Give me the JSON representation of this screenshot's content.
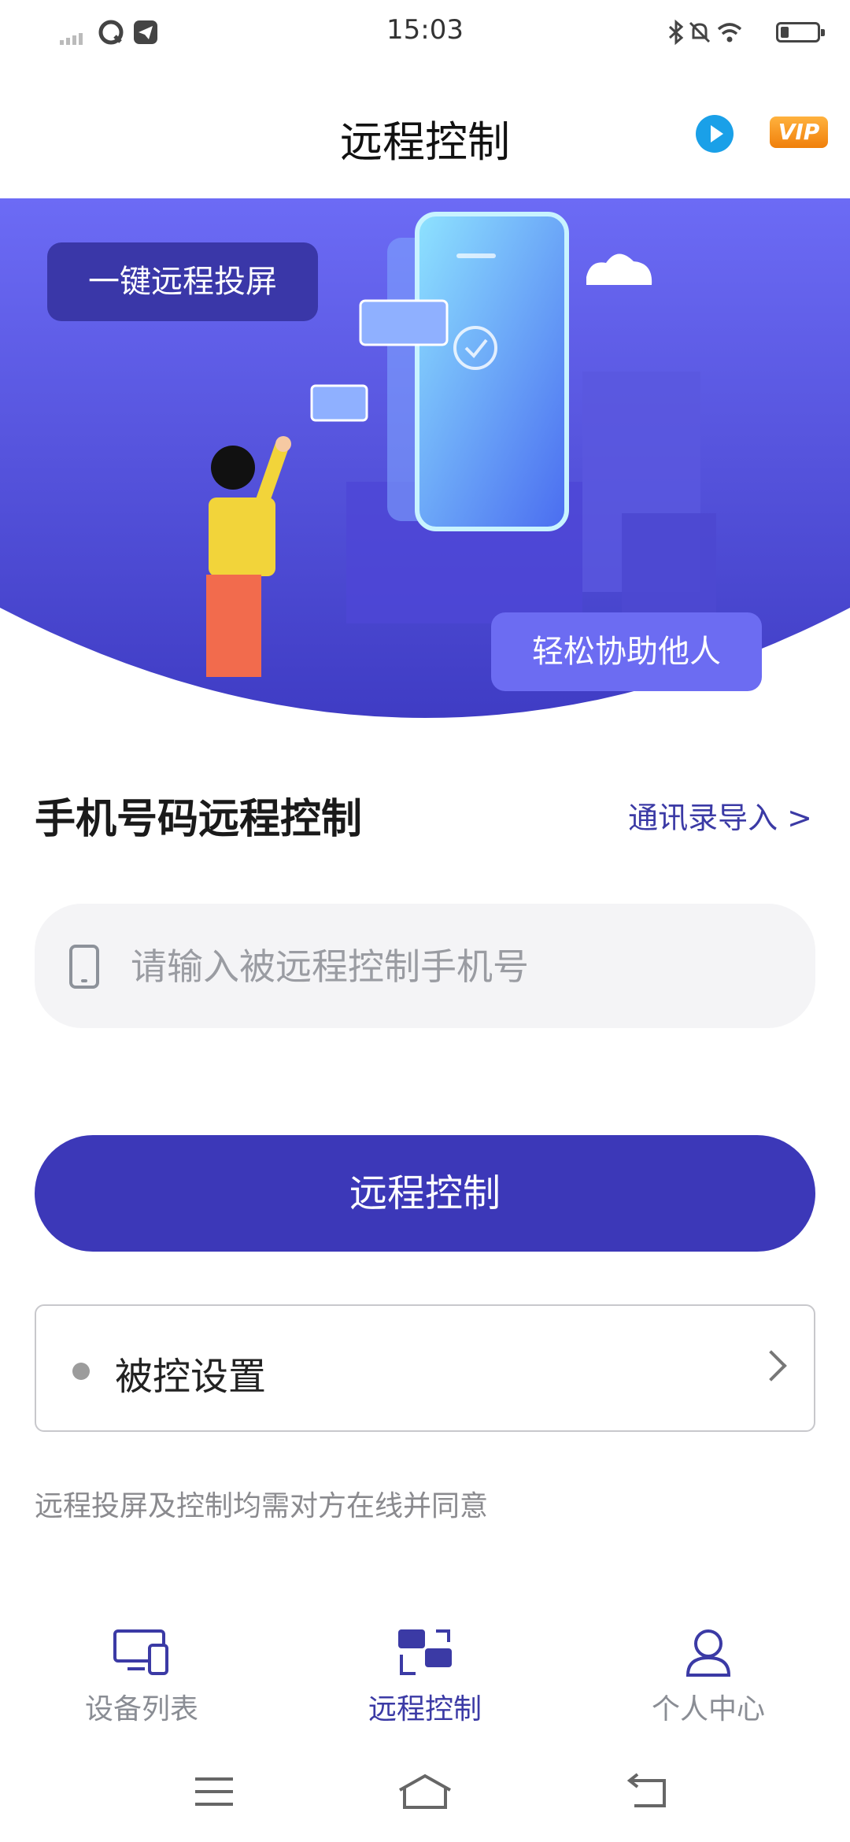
{
  "status_bar": {
    "time": "15:03"
  },
  "header": {
    "title": "远程控制",
    "vip_label": "VIP"
  },
  "banner": {
    "tag_top": "一键远程投屏",
    "tag_bottom": "轻松协助他人"
  },
  "section": {
    "title": "手机号码远程控制",
    "contacts_link": "通讯录导入 >"
  },
  "phone_input": {
    "placeholder": "请输入被远程控制手机号",
    "value": ""
  },
  "primary_button": {
    "label": "远程控制"
  },
  "settings_row": {
    "label": "被控设置"
  },
  "notice": "远程投屏及控制均需对方在线并同意",
  "tabs": [
    {
      "label": "设备列表",
      "icon": "devices-icon",
      "active": false
    },
    {
      "label": "远程控制",
      "icon": "remote-control-icon",
      "active": true
    },
    {
      "label": "个人中心",
      "icon": "person-icon",
      "active": false
    }
  ],
  "colors": {
    "primary": "#3c38b8",
    "banner_top": "#5f5cf0",
    "tab_active": "#3b3aa5",
    "tab_inactive": "#8a8d94"
  }
}
